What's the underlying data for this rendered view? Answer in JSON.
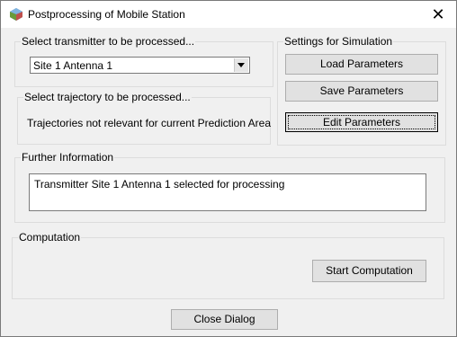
{
  "window": {
    "title": "Postprocessing of Mobile Station",
    "close_glyph": "✕",
    "icon": "app-logo-icon"
  },
  "transmitter": {
    "group_label": "Select transmitter to be processed...",
    "selected": "Site 1 Antenna 1"
  },
  "trajectory": {
    "group_label": "Select trajectory to be processed...",
    "message": "Trajectories not relevant  for current Prediction Area"
  },
  "settings": {
    "group_label": "Settings for Simulation",
    "load_label": "Load Parameters",
    "save_label": "Save Parameters",
    "edit_label": "Edit Parameters"
  },
  "info": {
    "group_label": "Further Information",
    "text": "Transmitter Site 1 Antenna 1 selected for processing"
  },
  "computation": {
    "group_label": "Computation",
    "start_label": "Start Computation"
  },
  "footer": {
    "close_label": "Close Dialog"
  }
}
